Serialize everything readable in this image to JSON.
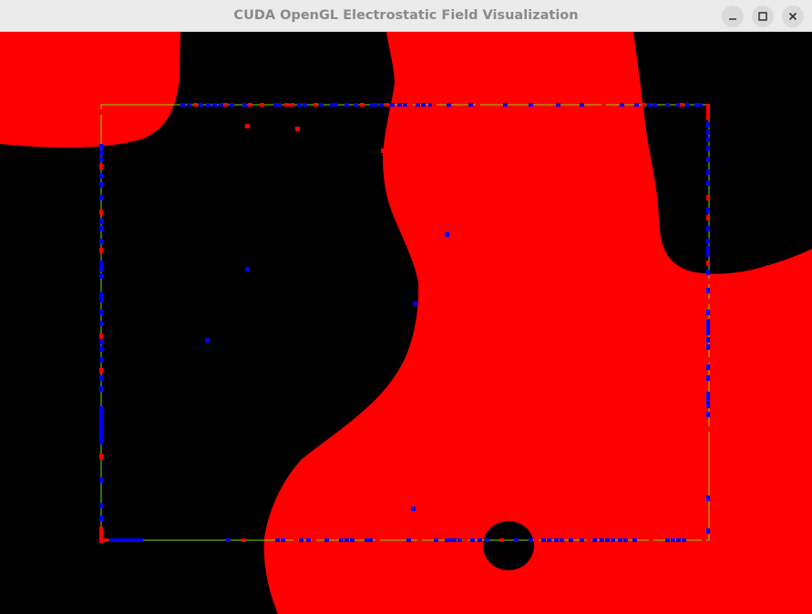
{
  "window": {
    "title": "CUDA OpenGL Electrostatic Field Visualization",
    "controls": [
      {
        "name": "minimize",
        "icon": "minimize-icon"
      },
      {
        "name": "maximize",
        "icon": "maximize-icon"
      },
      {
        "name": "close",
        "icon": "close-icon"
      }
    ]
  },
  "visualization": {
    "colors": {
      "background": "#000000",
      "positive_field": "#ff0000",
      "boundary": "#7fd400",
      "positive_charge": "#ff0000",
      "negative_charge": "#0000ff"
    }
  }
}
